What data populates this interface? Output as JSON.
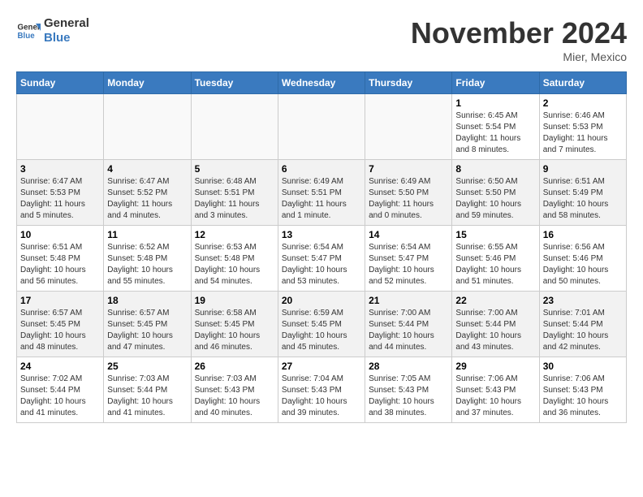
{
  "logo": {
    "line1": "General",
    "line2": "Blue"
  },
  "title": "November 2024",
  "subtitle": "Mier, Mexico",
  "days_header": [
    "Sunday",
    "Monday",
    "Tuesday",
    "Wednesday",
    "Thursday",
    "Friday",
    "Saturday"
  ],
  "weeks": [
    [
      {
        "day": "",
        "info": ""
      },
      {
        "day": "",
        "info": ""
      },
      {
        "day": "",
        "info": ""
      },
      {
        "day": "",
        "info": ""
      },
      {
        "day": "",
        "info": ""
      },
      {
        "day": "1",
        "info": "Sunrise: 6:45 AM\nSunset: 5:54 PM\nDaylight: 11 hours and 8 minutes."
      },
      {
        "day": "2",
        "info": "Sunrise: 6:46 AM\nSunset: 5:53 PM\nDaylight: 11 hours and 7 minutes."
      }
    ],
    [
      {
        "day": "3",
        "info": "Sunrise: 6:47 AM\nSunset: 5:53 PM\nDaylight: 11 hours and 5 minutes."
      },
      {
        "day": "4",
        "info": "Sunrise: 6:47 AM\nSunset: 5:52 PM\nDaylight: 11 hours and 4 minutes."
      },
      {
        "day": "5",
        "info": "Sunrise: 6:48 AM\nSunset: 5:51 PM\nDaylight: 11 hours and 3 minutes."
      },
      {
        "day": "6",
        "info": "Sunrise: 6:49 AM\nSunset: 5:51 PM\nDaylight: 11 hours and 1 minute."
      },
      {
        "day": "7",
        "info": "Sunrise: 6:49 AM\nSunset: 5:50 PM\nDaylight: 11 hours and 0 minutes."
      },
      {
        "day": "8",
        "info": "Sunrise: 6:50 AM\nSunset: 5:50 PM\nDaylight: 10 hours and 59 minutes."
      },
      {
        "day": "9",
        "info": "Sunrise: 6:51 AM\nSunset: 5:49 PM\nDaylight: 10 hours and 58 minutes."
      }
    ],
    [
      {
        "day": "10",
        "info": "Sunrise: 6:51 AM\nSunset: 5:48 PM\nDaylight: 10 hours and 56 minutes."
      },
      {
        "day": "11",
        "info": "Sunrise: 6:52 AM\nSunset: 5:48 PM\nDaylight: 10 hours and 55 minutes."
      },
      {
        "day": "12",
        "info": "Sunrise: 6:53 AM\nSunset: 5:48 PM\nDaylight: 10 hours and 54 minutes."
      },
      {
        "day": "13",
        "info": "Sunrise: 6:54 AM\nSunset: 5:47 PM\nDaylight: 10 hours and 53 minutes."
      },
      {
        "day": "14",
        "info": "Sunrise: 6:54 AM\nSunset: 5:47 PM\nDaylight: 10 hours and 52 minutes."
      },
      {
        "day": "15",
        "info": "Sunrise: 6:55 AM\nSunset: 5:46 PM\nDaylight: 10 hours and 51 minutes."
      },
      {
        "day": "16",
        "info": "Sunrise: 6:56 AM\nSunset: 5:46 PM\nDaylight: 10 hours and 50 minutes."
      }
    ],
    [
      {
        "day": "17",
        "info": "Sunrise: 6:57 AM\nSunset: 5:45 PM\nDaylight: 10 hours and 48 minutes."
      },
      {
        "day": "18",
        "info": "Sunrise: 6:57 AM\nSunset: 5:45 PM\nDaylight: 10 hours and 47 minutes."
      },
      {
        "day": "19",
        "info": "Sunrise: 6:58 AM\nSunset: 5:45 PM\nDaylight: 10 hours and 46 minutes."
      },
      {
        "day": "20",
        "info": "Sunrise: 6:59 AM\nSunset: 5:45 PM\nDaylight: 10 hours and 45 minutes."
      },
      {
        "day": "21",
        "info": "Sunrise: 7:00 AM\nSunset: 5:44 PM\nDaylight: 10 hours and 44 minutes."
      },
      {
        "day": "22",
        "info": "Sunrise: 7:00 AM\nSunset: 5:44 PM\nDaylight: 10 hours and 43 minutes."
      },
      {
        "day": "23",
        "info": "Sunrise: 7:01 AM\nSunset: 5:44 PM\nDaylight: 10 hours and 42 minutes."
      }
    ],
    [
      {
        "day": "24",
        "info": "Sunrise: 7:02 AM\nSunset: 5:44 PM\nDaylight: 10 hours and 41 minutes."
      },
      {
        "day": "25",
        "info": "Sunrise: 7:03 AM\nSunset: 5:44 PM\nDaylight: 10 hours and 41 minutes."
      },
      {
        "day": "26",
        "info": "Sunrise: 7:03 AM\nSunset: 5:43 PM\nDaylight: 10 hours and 40 minutes."
      },
      {
        "day": "27",
        "info": "Sunrise: 7:04 AM\nSunset: 5:43 PM\nDaylight: 10 hours and 39 minutes."
      },
      {
        "day": "28",
        "info": "Sunrise: 7:05 AM\nSunset: 5:43 PM\nDaylight: 10 hours and 38 minutes."
      },
      {
        "day": "29",
        "info": "Sunrise: 7:06 AM\nSunset: 5:43 PM\nDaylight: 10 hours and 37 minutes."
      },
      {
        "day": "30",
        "info": "Sunrise: 7:06 AM\nSunset: 5:43 PM\nDaylight: 10 hours and 36 minutes."
      }
    ]
  ]
}
